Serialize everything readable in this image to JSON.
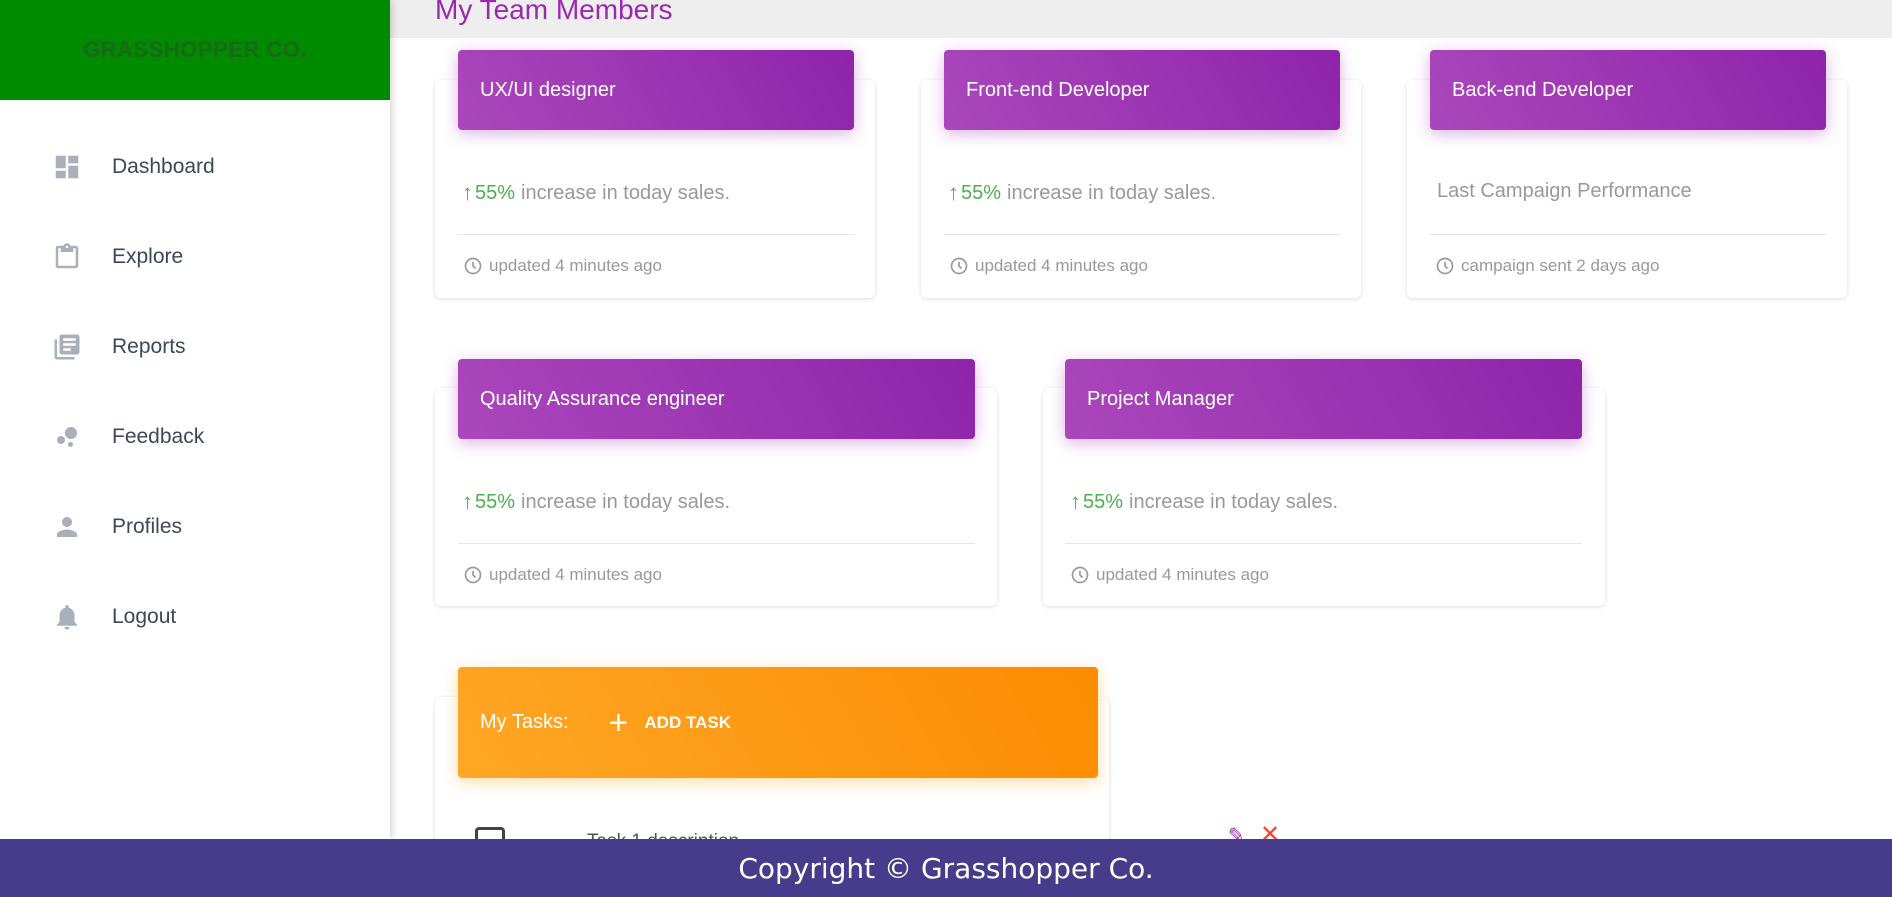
{
  "brand": {
    "name": "GRASSHOPPER CO.",
    "color": "#008a00"
  },
  "sidebar": {
    "items": [
      {
        "label": "Dashboard",
        "icon": "dashboard-icon"
      },
      {
        "label": "Explore",
        "icon": "clipboard-icon"
      },
      {
        "label": "Reports",
        "icon": "library-books-icon"
      },
      {
        "label": "Feedback",
        "icon": "bubble-chart-icon"
      },
      {
        "label": "Profiles",
        "icon": "person-icon"
      },
      {
        "label": "Logout",
        "icon": "bell-icon"
      }
    ]
  },
  "main": {
    "title": "My Team Members",
    "cards": [
      {
        "title": "UX/UI designer",
        "percent": "55%",
        "stat": "increase in today sales.",
        "footer": "updated 4 minutes ago"
      },
      {
        "title": "Front-end Developer",
        "percent": "55%",
        "stat": "increase in today sales.",
        "footer": "updated 4 minutes ago"
      },
      {
        "title": "Back-end Developer",
        "percent": "",
        "stat": "Last Campaign Performance",
        "footer": "campaign sent 2 days ago"
      },
      {
        "title": "Quality Assurance engineer",
        "percent": "55%",
        "stat": "increase in today sales.",
        "footer": "updated 4 minutes ago"
      },
      {
        "title": "Project Manager",
        "percent": "55%",
        "stat": "increase in today sales.",
        "footer": "updated 4 minutes ago"
      }
    ],
    "tasks": {
      "label": "My Tasks:",
      "add_label": "ADD TASK",
      "items": [
        {
          "text": "Task 1 description"
        }
      ]
    }
  },
  "footer": {
    "text": "Copyright © Grasshopper Co."
  },
  "colors": {
    "purple": "#9c27b0",
    "orange": "#fb8c00",
    "green": "#4caf50",
    "footer": "#473c8b"
  }
}
